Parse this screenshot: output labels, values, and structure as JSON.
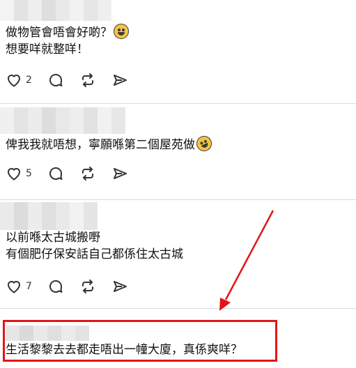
{
  "posts": [
    {
      "lines": [
        "做物管會唔會好啲？",
        "想要咩就整咩！"
      ],
      "emoji_after_line": 0,
      "emoji": "grinning-sweat-emoji",
      "like_count": "2"
    },
    {
      "lines": [
        "俾我我就唔想，寧願喺第二個屋苑做"
      ],
      "emoji_after_line": 0,
      "emoji": "rolling-laughing-emoji",
      "like_count": "5"
    },
    {
      "lines": [
        "以前喺太古城搬嘢",
        "有個肥仔保安話自己都係住太古城"
      ],
      "like_count": "7"
    },
    {
      "lines": [
        "生活黎黎去去都走唔出一幢大廈，真係爽咩？"
      ]
    }
  ],
  "actions": {
    "icons": [
      "heart-icon",
      "comment-icon",
      "repost-icon",
      "share-icon"
    ]
  },
  "annotation": {
    "color": "#e01616"
  }
}
